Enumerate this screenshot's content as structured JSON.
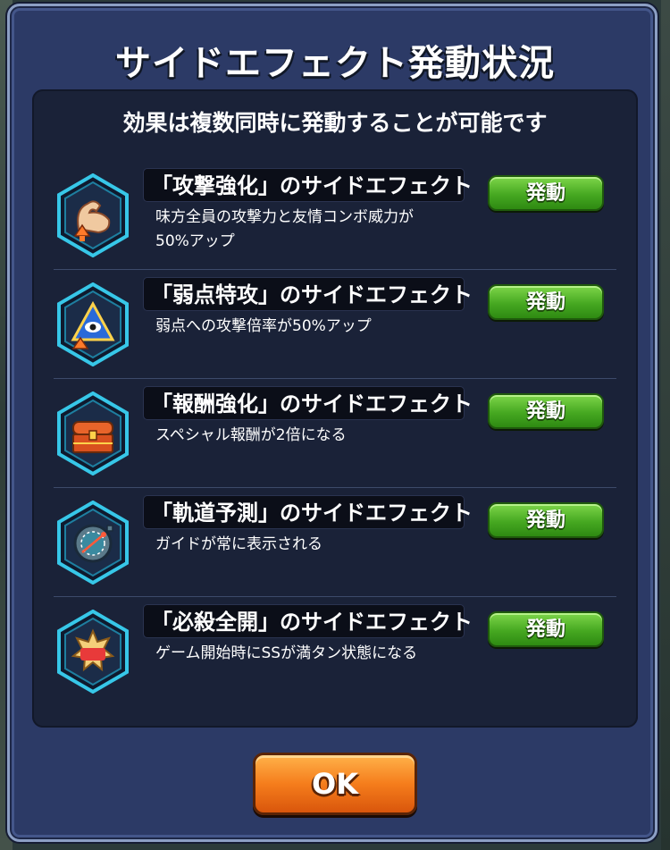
{
  "dialog": {
    "title": "サイドエフェクト発動状況",
    "subtitle": "効果は複数同時に発動することが可能です",
    "effects": [
      {
        "name": "「攻撃強化」のサイドエフェクト",
        "desc_line1": "味方全員の攻撃力と友情コンボ威力が",
        "desc_line2": "50%アップ",
        "status": "発動",
        "icon": "muscle-arm-icon"
      },
      {
        "name": "「弱点特攻」のサイドエフェクト",
        "desc_line1": "弱点への攻撃倍率が50%アップ",
        "desc_line2": "",
        "status": "発動",
        "icon": "weak-point-eye-icon"
      },
      {
        "name": "「報酬強化」のサイドエフェクト",
        "desc_line1": "スペシャル報酬が2倍になる",
        "desc_line2": "",
        "status": "発動",
        "icon": "treasure-chest-icon"
      },
      {
        "name": "「軌道予測」のサイドエフェクト",
        "desc_line1": "ガイドが常に表示される",
        "desc_line2": "",
        "status": "発動",
        "icon": "trajectory-target-icon"
      },
      {
        "name": "「必殺全開」のサイドエフェクト",
        "desc_line1": "ゲーム開始時にSSが満タン状態になる",
        "desc_line2": "",
        "status": "発動",
        "icon": "go-burst-icon"
      }
    ],
    "ok_label": "OK"
  },
  "colors": {
    "dialog_bg": "#2c3a66",
    "panel_bg": "#1a2238",
    "activate_green": "#46a821",
    "ok_orange": "#f57d1c",
    "hex_cyan": "#37c7e8"
  }
}
